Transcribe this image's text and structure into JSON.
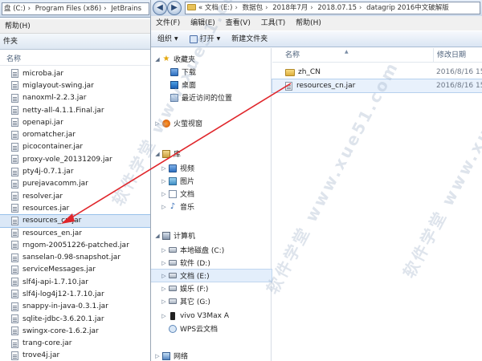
{
  "left_window": {
    "address": [
      "盘 (C:)",
      "Program Files (x86)",
      "JetBrains"
    ],
    "menu_help": "帮助(H)",
    "toolbar_label": "件夹",
    "column_name": "名称",
    "files": [
      "microba.jar",
      "miglayout-swing.jar",
      "nanoxml-2.2.3.jar",
      "netty-all-4.1.1.Final.jar",
      "openapi.jar",
      "oromatcher.jar",
      "picocontainer.jar",
      "proxy-vole_20131209.jar",
      "pty4j-0.7.1.jar",
      "purejavacomm.jar",
      "resolver.jar",
      "resources.jar",
      "resources_cn.jar",
      "resources_en.jar",
      "rngom-20051226-patched.jar",
      "sanselan-0.98-snapshot.jar",
      "serviceMessages.jar",
      "slf4j-api-1.7.10.jar",
      "slf4j-log4j12-1.7.10.jar",
      "snappy-in-java-0.3.1.jar",
      "sqlite-jdbc-3.6.20.1.jar",
      "swingx-core-1.6.2.jar",
      "trang-core.jar",
      "trove4j.jar"
    ],
    "selected_index": 12
  },
  "right_window": {
    "address_prefix": "«",
    "breadcrumbs": [
      "文档 (E:)",
      "数据包",
      "2018年7月",
      "2018.07.15",
      "datagrip 2016中文破解版"
    ],
    "menu": [
      "文件(F)",
      "编辑(E)",
      "查看(V)",
      "工具(T)",
      "帮助(H)"
    ],
    "toolbar": {
      "organize": "组织",
      "open": "打开",
      "new_folder": "新建文件夹"
    },
    "nav": {
      "favorites": "收藏夹",
      "downloads": "下载",
      "desktop": "桌面",
      "recent": "最近访问的位置",
      "huorong": "火萤视窗",
      "libraries": "库",
      "videos": "视频",
      "pictures": "图片",
      "documents": "文档",
      "music": "音乐",
      "computer": "计算机",
      "drive_c": "本地磁盘 (C:)",
      "drive_d": "软件 (D:)",
      "drive_e": "文档 (E:)",
      "drive_f": "娱乐 (F:)",
      "drive_g": "其它 (G:)",
      "phone": "vivo V3Max A",
      "wps": "WPS云文档",
      "network": "网络"
    },
    "columns": {
      "name": "名称",
      "date": "修改日期"
    },
    "files": [
      {
        "name": "zh_CN",
        "date": "2016/8/16 15",
        "type": "folder"
      },
      {
        "name": "resources_cn.jar",
        "date": "2016/8/16 15",
        "type": "jar"
      }
    ]
  },
  "watermark": "软件学堂 www.xue51.com",
  "colors": {
    "selection": "#dbe8f7",
    "arrow": "#e0262b",
    "header_text": "#4c607a"
  }
}
